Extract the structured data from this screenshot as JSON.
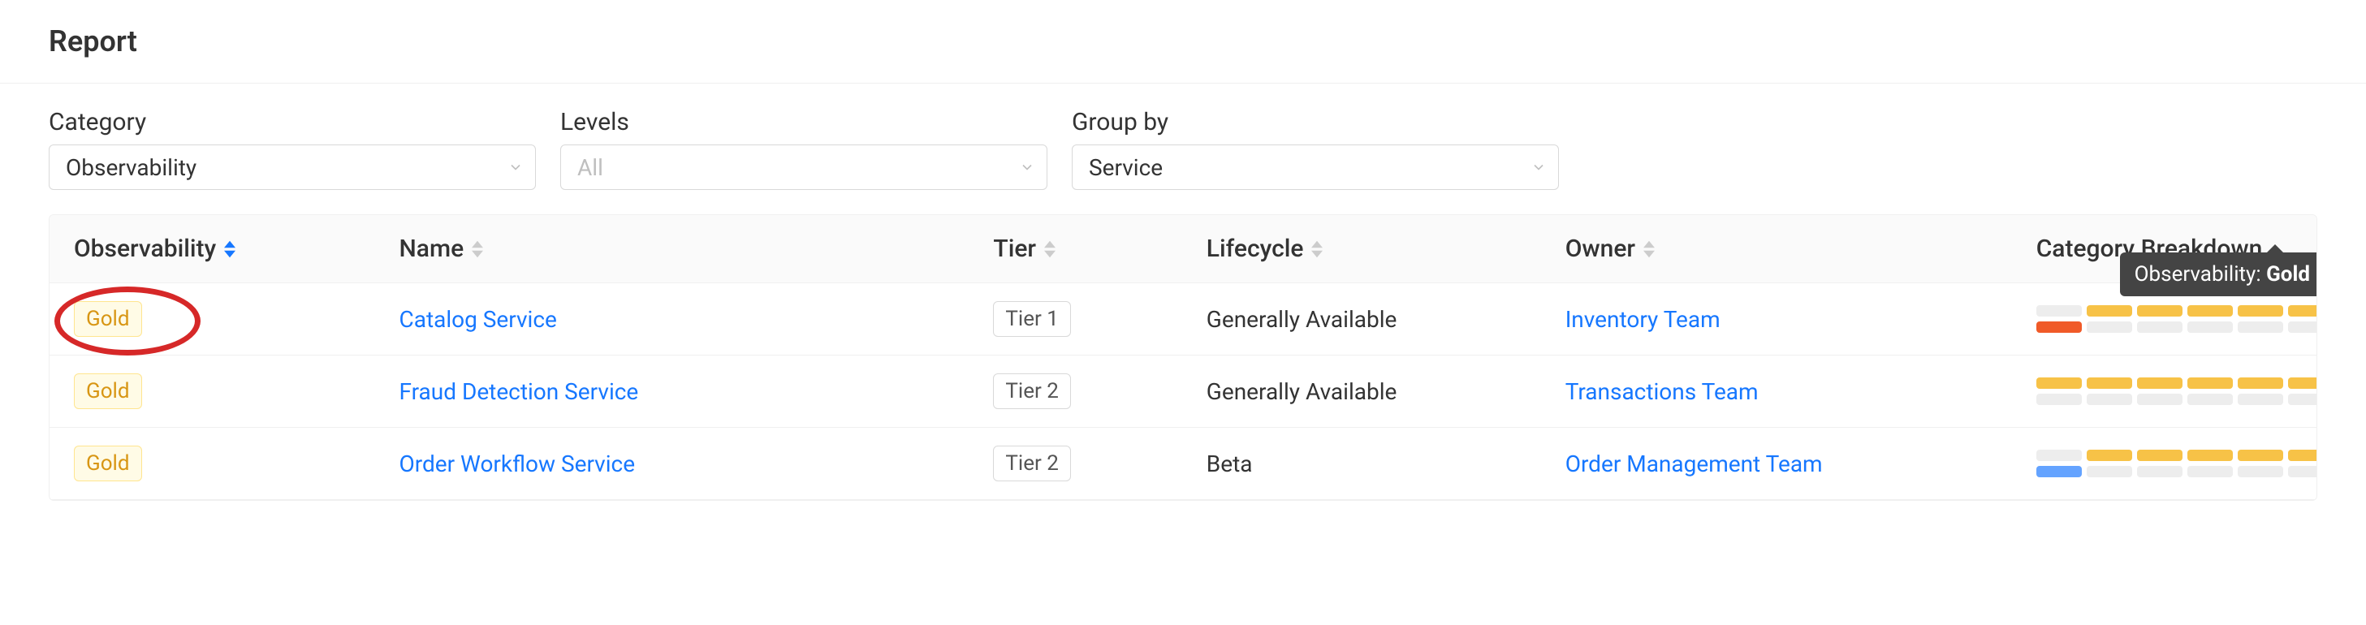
{
  "page_title": "Report",
  "filters": {
    "category": {
      "label": "Category",
      "value": "Observability"
    },
    "levels": {
      "label": "Levels",
      "placeholder": "All"
    },
    "group_by": {
      "label": "Group by",
      "value": "Service"
    }
  },
  "columns": {
    "level": "Observability",
    "name": "Name",
    "tier": "Tier",
    "lifecycle": "Lifecycle",
    "owner": "Owner",
    "breakdown": "Category Breakdown"
  },
  "rows": [
    {
      "level": "Gold",
      "name": "Catalog Service",
      "tier": "Tier 1",
      "lifecycle": "Generally Available",
      "owner": "Inventory Team",
      "breakdown": [
        [
          "gray",
          "red"
        ],
        [
          "gold",
          "gray"
        ],
        [
          "gold",
          "gray"
        ],
        [
          "gold",
          "gray"
        ],
        [
          "gold",
          "gray"
        ],
        [
          "gold",
          "gray"
        ]
      ],
      "annot": true
    },
    {
      "level": "Gold",
      "name": "Fraud Detection Service",
      "tier": "Tier 2",
      "lifecycle": "Generally Available",
      "owner": "Transactions Team",
      "breakdown": [
        [
          "gold",
          "gray"
        ],
        [
          "gold",
          "gray"
        ],
        [
          "gold",
          "gray"
        ],
        [
          "gold",
          "gray"
        ],
        [
          "gold",
          "gray"
        ],
        [
          "gold",
          "gray"
        ]
      ]
    },
    {
      "level": "Gold",
      "name": "Order Workflow Service",
      "tier": "Tier 2",
      "lifecycle": "Beta",
      "owner": "Order Management Team",
      "breakdown": [
        [
          "gray",
          "blue"
        ],
        [
          "gold",
          "gray"
        ],
        [
          "gold",
          "gray"
        ],
        [
          "gold",
          "gray"
        ],
        [
          "gold",
          "gray"
        ],
        [
          "gold",
          "gray"
        ]
      ]
    }
  ],
  "tooltip": {
    "label": "Observability",
    "value": "Gold"
  }
}
